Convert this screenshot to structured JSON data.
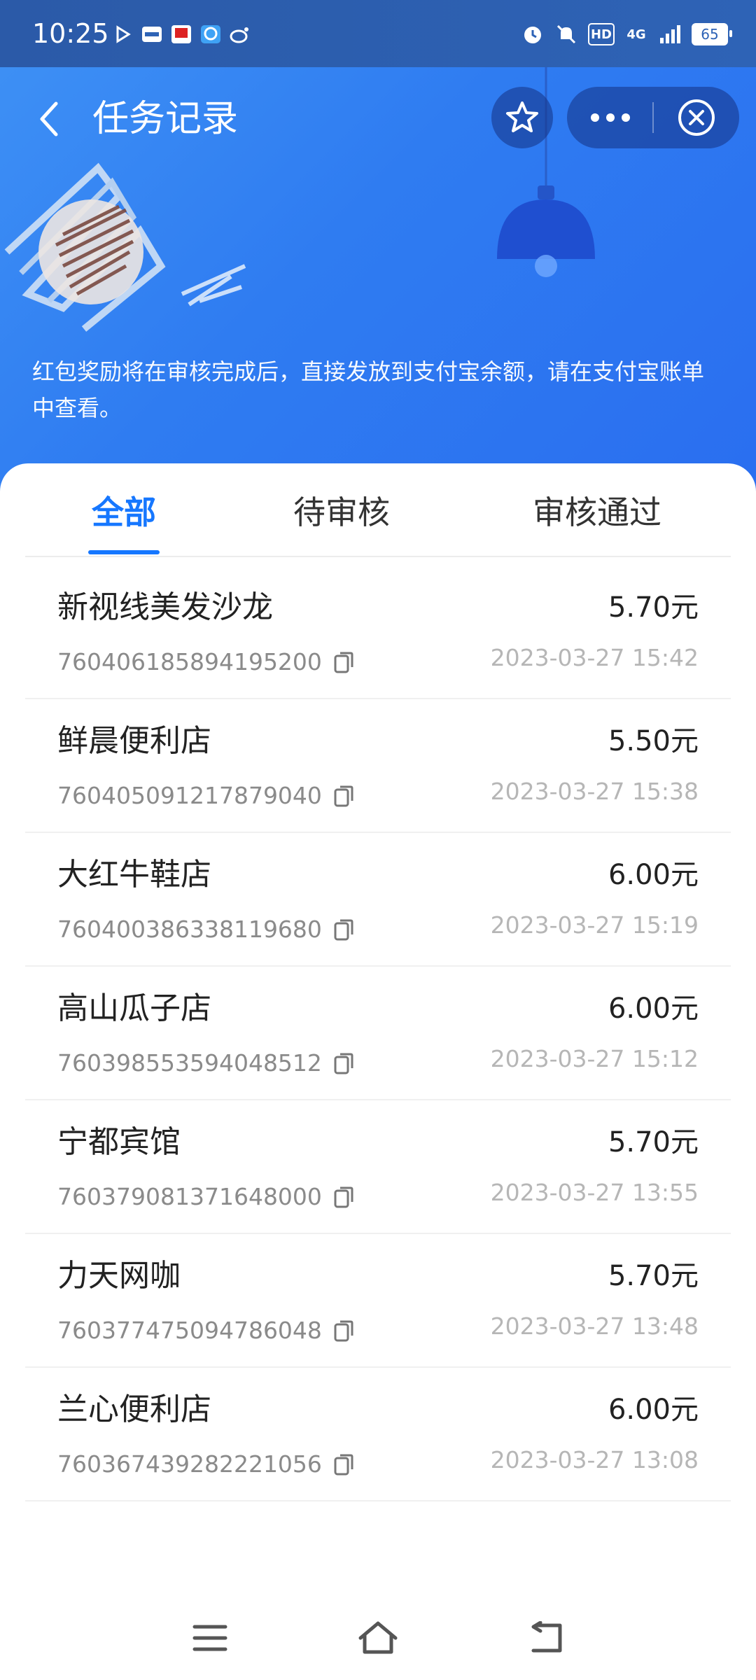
{
  "status_bar": {
    "time": "10:25",
    "app_icons": [
      "play-icon",
      "youku-icon",
      "kfc-icon",
      "eleme-icon",
      "weibo-icon"
    ],
    "network": "4G",
    "hd_label": "HD",
    "battery": "65"
  },
  "header": {
    "title": "任务记录",
    "notice": "红包奖励将在审核完成后，直接发放到支付宝余额，请在支付宝账单中查看。"
  },
  "tabs": [
    {
      "label": "全部",
      "active": true
    },
    {
      "label": "待审核",
      "active": false
    },
    {
      "label": "审核通过",
      "active": false
    }
  ],
  "records": [
    {
      "name": "新视线美发沙龙",
      "id": "760406185894195200",
      "amount": "5.70元",
      "time": "2023-03-27 15:42"
    },
    {
      "name": "鲜晨便利店",
      "id": "760405091217879040",
      "amount": "5.50元",
      "time": "2023-03-27 15:38"
    },
    {
      "name": "大红牛鞋店",
      "id": "760400386338119680",
      "amount": "6.00元",
      "time": "2023-03-27 15:19"
    },
    {
      "name": "高山瓜子店",
      "id": "760398553594048512",
      "amount": "6.00元",
      "time": "2023-03-27 15:12"
    },
    {
      "name": "宁都宾馆",
      "id": "760379081371648000",
      "amount": "5.70元",
      "time": "2023-03-27 13:55"
    },
    {
      "name": "力天网咖",
      "id": "760377475094786048",
      "amount": "5.70元",
      "time": "2023-03-27 13:48"
    },
    {
      "name": "兰心便利店",
      "id": "760367439282221056",
      "amount": "6.00元",
      "time": "2023-03-27 13:08"
    }
  ],
  "colors": {
    "accent": "#1677ff",
    "header_blue": "#2f7cf1"
  }
}
